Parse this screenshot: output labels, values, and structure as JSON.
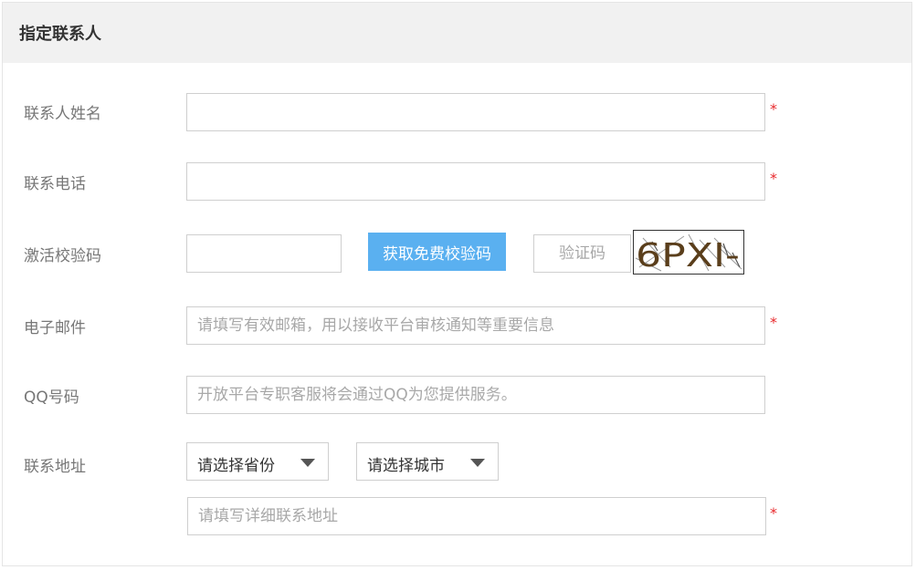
{
  "panel": {
    "title": "指定联系人"
  },
  "form": {
    "name": {
      "label": "联系人姓名",
      "value": "",
      "required_mark": "*"
    },
    "phone": {
      "label": "联系电话",
      "value": "",
      "required_mark": "*"
    },
    "activation": {
      "label": "激活校验码",
      "value": "",
      "send_button": "获取免费校验码",
      "captcha_placeholder": "验证码",
      "captcha_image_text": "6PXI-"
    },
    "email": {
      "label": "电子邮件",
      "placeholder": "请填写有效邮箱，用以接收平台审核通知等重要信息",
      "required_mark": "*"
    },
    "qq": {
      "label": "QQ号码",
      "placeholder": "开放平台专职客服将会通过QQ为您提供服务。"
    },
    "address": {
      "label": "联系地址",
      "province_select": "请选择省份",
      "city_select": "请选择城市",
      "detail_placeholder": "请填写详细联系地址",
      "required_mark": "*"
    }
  },
  "colors": {
    "header_bg": "#f1f1f1",
    "primary_button": "#5ab0f0",
    "required_star": "#e8282b",
    "border": "#cfcfcf"
  }
}
